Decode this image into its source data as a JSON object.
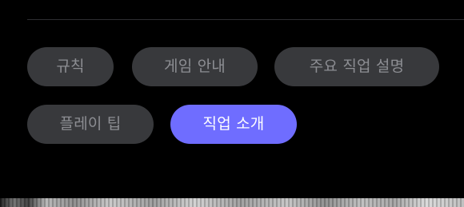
{
  "tabs": [
    {
      "label": "규칙",
      "active": false
    },
    {
      "label": "게임 안내",
      "active": false
    },
    {
      "label": "주요 직업 설명",
      "active": false
    },
    {
      "label": "플레이 팁",
      "active": false
    },
    {
      "label": "직업 소개",
      "active": true
    }
  ],
  "colors": {
    "background": "#000000",
    "chip_background": "#38393c",
    "chip_text": "#8d8e93",
    "active_background": "#6f6dff",
    "active_text": "#ffffff"
  }
}
